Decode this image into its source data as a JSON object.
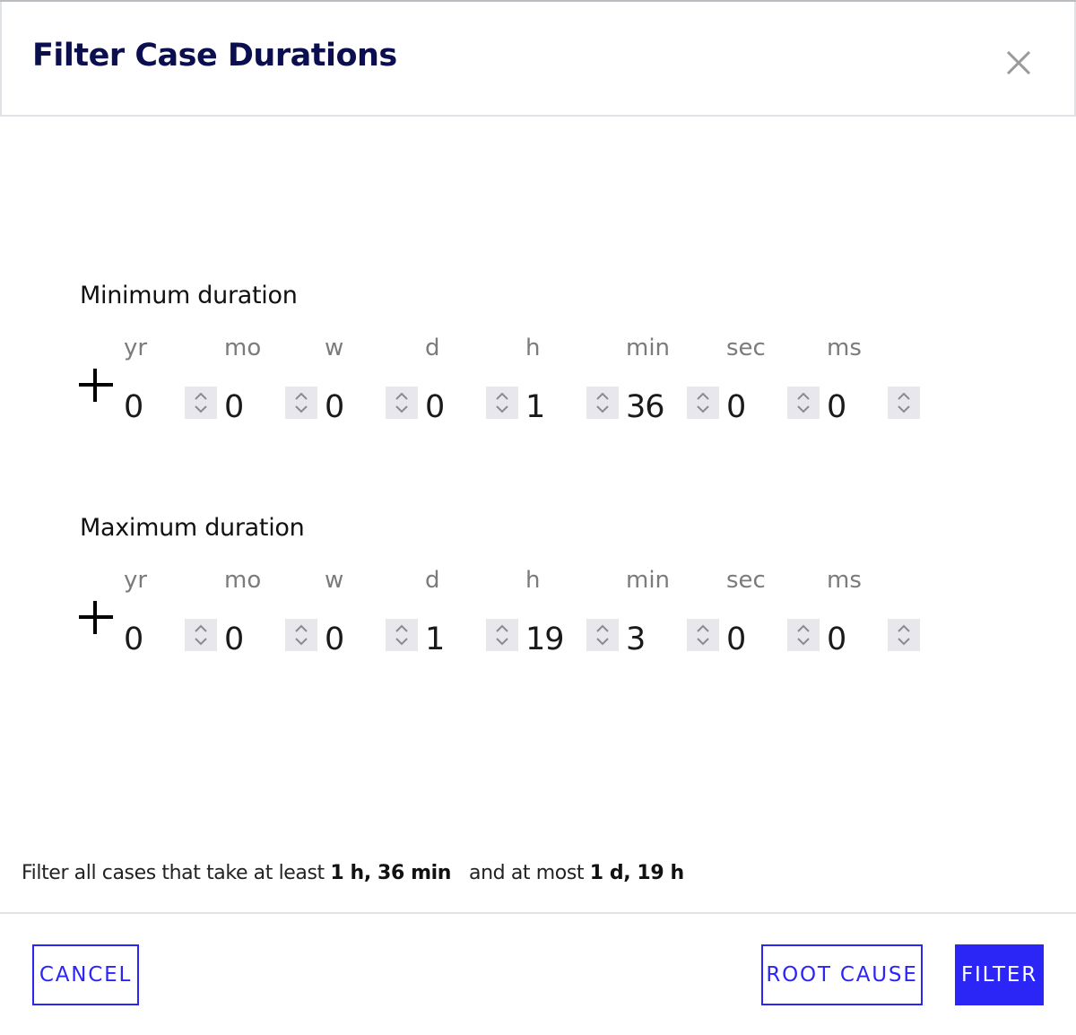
{
  "dialog": {
    "title": "Filter Case Durations",
    "close_icon": "close-icon"
  },
  "units": [
    "yr",
    "mo",
    "w",
    "d",
    "h",
    "min",
    "sec",
    "ms"
  ],
  "minimum": {
    "label": "Minimum duration",
    "sign": "+",
    "values": [
      "0",
      "0",
      "0",
      "0",
      "1",
      "36",
      "0",
      "0"
    ]
  },
  "maximum": {
    "label": "Maximum duration",
    "sign": "+",
    "values": [
      "0",
      "0",
      "0",
      "1",
      "19",
      "3",
      "0",
      "0"
    ]
  },
  "summary": {
    "prefix": "Filter all cases that take at least ",
    "min_text": "1 h, 36 min",
    "middle": "and at most ",
    "max_text": "1 d, 19 h"
  },
  "buttons": {
    "cancel": "CANCEL",
    "root_cause": "ROOT CAUSE",
    "filter": "FILTER"
  },
  "colors": {
    "accent": "#2b25f5",
    "title": "#0b0f4f",
    "stepper_bg": "#e7e7ec",
    "unit_label": "#7b7b7b"
  }
}
